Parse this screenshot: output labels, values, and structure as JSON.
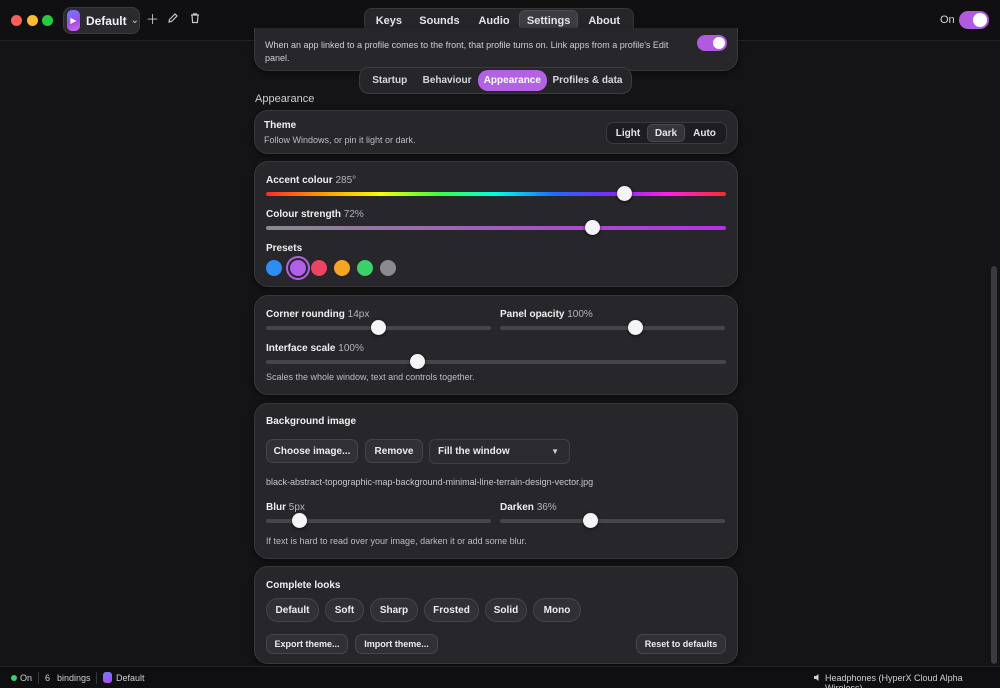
{
  "titlebar": {
    "profile_name": "Default",
    "add_icon": "plus-icon",
    "edit_icon": "pencil-icon",
    "delete_icon": "trash-icon",
    "on_label": "On"
  },
  "topnav": {
    "tabs": [
      {
        "label": "Keys"
      },
      {
        "label": "Sounds"
      },
      {
        "label": "Audio"
      },
      {
        "label": "Settings",
        "active": true
      },
      {
        "label": "About"
      }
    ]
  },
  "profiles_card": {
    "text": "When an app linked to a profile comes to the front, that profile turns on. Link apps from a profile's Edit panel."
  },
  "subnav": {
    "tabs": [
      {
        "label": "Startup"
      },
      {
        "label": "Behaviour"
      },
      {
        "label": "Appearance",
        "active": true
      },
      {
        "label": "Profiles & data"
      }
    ]
  },
  "appearance": {
    "heading": "Appearance",
    "theme": {
      "title": "Theme",
      "desc": "Follow Windows, or pin it light or dark.",
      "options": [
        "Light",
        "Dark",
        "Auto"
      ],
      "selected": "Dark"
    },
    "accent": {
      "label": "Accent colour",
      "value": "285°",
      "level": 0.78
    },
    "strength": {
      "label": "Colour strength",
      "value": "72%",
      "level": 0.71
    },
    "presets": {
      "label": "Presets",
      "colors": [
        "#2f8cf0",
        "#b35ee6",
        "#e94560",
        "#f5a524",
        "#3ccf6a",
        "#8a8a8f"
      ],
      "selected_index": 1
    },
    "corner": {
      "label": "Corner rounding",
      "value": "14px",
      "level": 0.5
    },
    "opacity": {
      "label": "Panel opacity",
      "value": "100%",
      "level": 0.6
    },
    "scale": {
      "label": "Interface scale",
      "value": "100%",
      "level": 0.33
    },
    "scale_desc": "Scales the whole window, text and controls together.",
    "background": {
      "title": "Background image",
      "choose_label": "Choose image...",
      "remove_label": "Remove",
      "fit_value": "Fill the window",
      "filename": "black-abstract-topographic-map-background-minimal-line-terrain-design-vector.jpg",
      "blur": {
        "label": "Blur",
        "value": "5px",
        "level": 0.15
      },
      "darken": {
        "label": "Darken",
        "value": "36%",
        "level": 0.4
      },
      "hint": "If text is hard to read over your image, darken it or add some blur."
    },
    "looks": {
      "title": "Complete looks",
      "options": [
        "Default",
        "Soft",
        "Sharp",
        "Frosted",
        "Solid",
        "Mono"
      ],
      "export_label": "Export theme...",
      "import_label": "Import theme...",
      "reset_label": "Reset to defaults"
    }
  },
  "statusbar": {
    "state": "On",
    "bindings_count": "6",
    "bindings_label": "bindings",
    "profile": "Default",
    "device": "Headphones (HyperX Cloud Alpha Wireless)"
  },
  "colors": {
    "accent": "#b561e3",
    "bg": "#141416",
    "card": "#26262b"
  }
}
